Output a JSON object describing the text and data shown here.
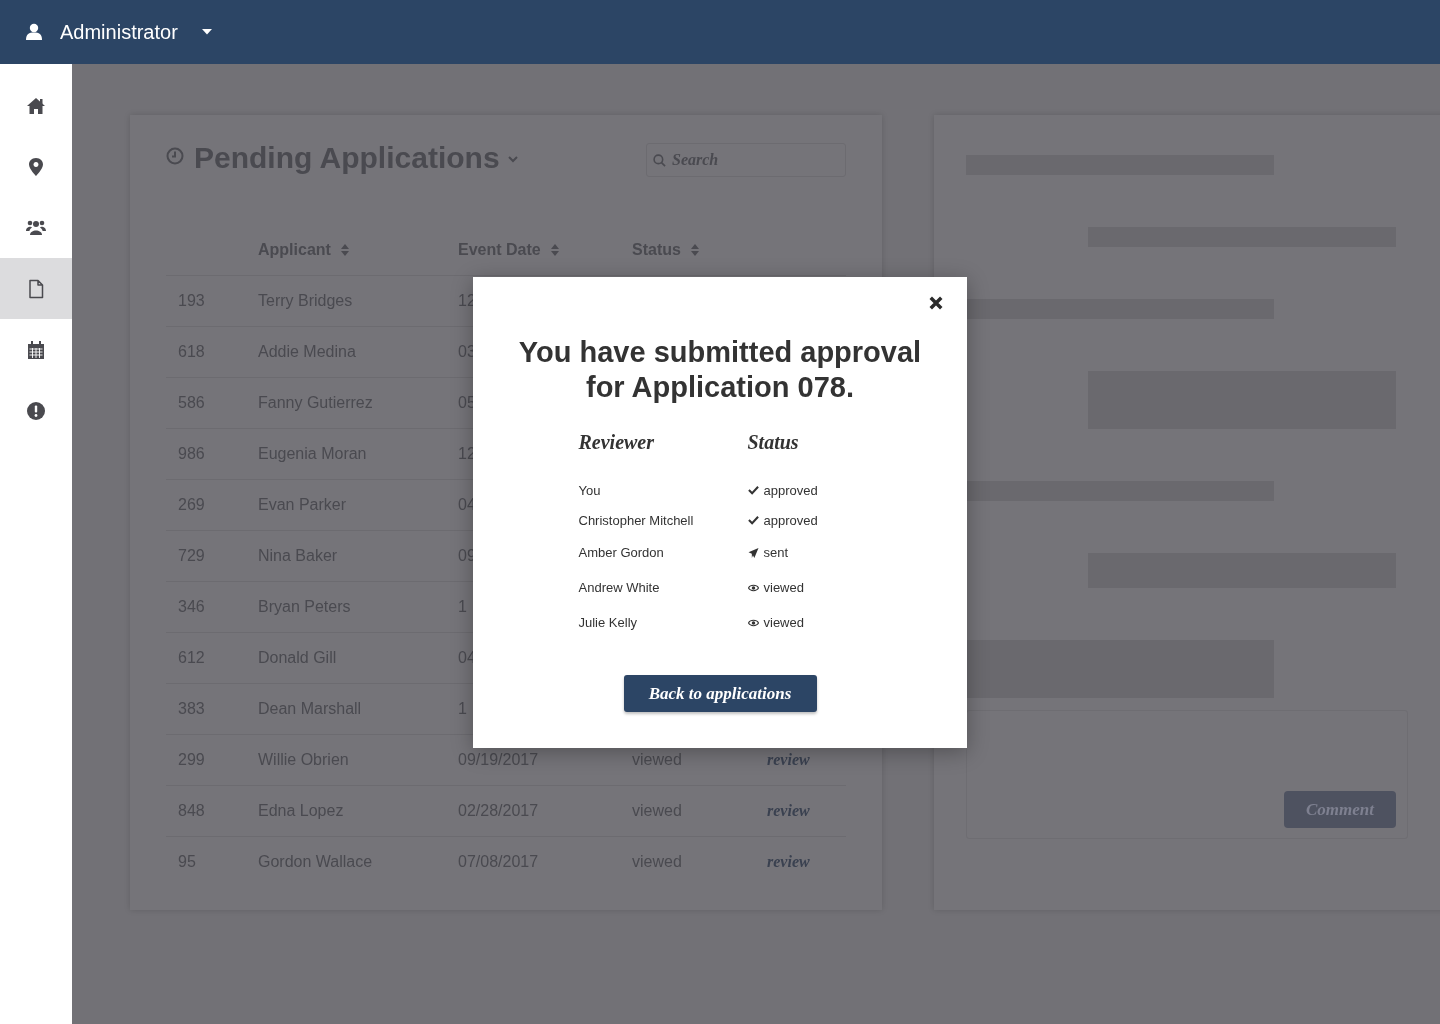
{
  "header": {
    "user": "Administrator"
  },
  "sidebar": {
    "items": [
      {
        "selected": false
      },
      {
        "selected": false
      },
      {
        "selected": false
      },
      {
        "selected": true
      },
      {
        "selected": false
      },
      {
        "selected": false
      }
    ]
  },
  "applications": {
    "title": "Pending Applications",
    "search": {
      "placeholder": "Search"
    },
    "columns": [
      "Applicant",
      "Event Date",
      "Status"
    ],
    "rows": [
      {
        "id": "193",
        "applicant": "Terry Bridges",
        "event_date": "12"
      },
      {
        "id": "618",
        "applicant": "Addie Medina",
        "event_date": "03"
      },
      {
        "id": "586",
        "applicant": "Fanny Gutierrez",
        "event_date": "05"
      },
      {
        "id": "986",
        "applicant": "Eugenia Moran",
        "event_date": "12"
      },
      {
        "id": "269",
        "applicant": "Evan Parker",
        "event_date": "04"
      },
      {
        "id": "729",
        "applicant": "Nina Baker",
        "event_date": "09"
      },
      {
        "id": "346",
        "applicant": "Bryan Peters",
        "event_date": "1"
      },
      {
        "id": "612",
        "applicant": "Donald Gill",
        "event_date": "04"
      },
      {
        "id": "383",
        "applicant": "Dean Marshall",
        "event_date": "1"
      },
      {
        "id": "299",
        "applicant": "Willie Obrien",
        "event_date": "09/19/2017",
        "status": "viewed",
        "action": "review"
      },
      {
        "id": "848",
        "applicant": "Edna Lopez",
        "event_date": "02/28/2017",
        "status": "viewed",
        "action": "review"
      },
      {
        "id": "95",
        "applicant": "Gordon Wallace",
        "event_date": "07/08/2017",
        "status": "viewed",
        "action": "review"
      }
    ]
  },
  "detail": {
    "comment_button": "Comment"
  },
  "modal": {
    "title": "You have submitted approval for Application 078.",
    "columns": [
      "Reviewer",
      "Status"
    ],
    "reviewers": [
      {
        "name": "You",
        "kind": "approved",
        "status": "approved"
      },
      {
        "name": "Christopher Mitchell",
        "kind": "approved",
        "status": "approved"
      },
      {
        "name": "Amber Gordon",
        "kind": "sent",
        "status": "sent"
      },
      {
        "name": "Andrew White",
        "kind": "viewed",
        "status": "viewed"
      },
      {
        "name": "Julie Kelly",
        "kind": "viewed",
        "status": "viewed"
      }
    ],
    "button": "Back to applications"
  }
}
